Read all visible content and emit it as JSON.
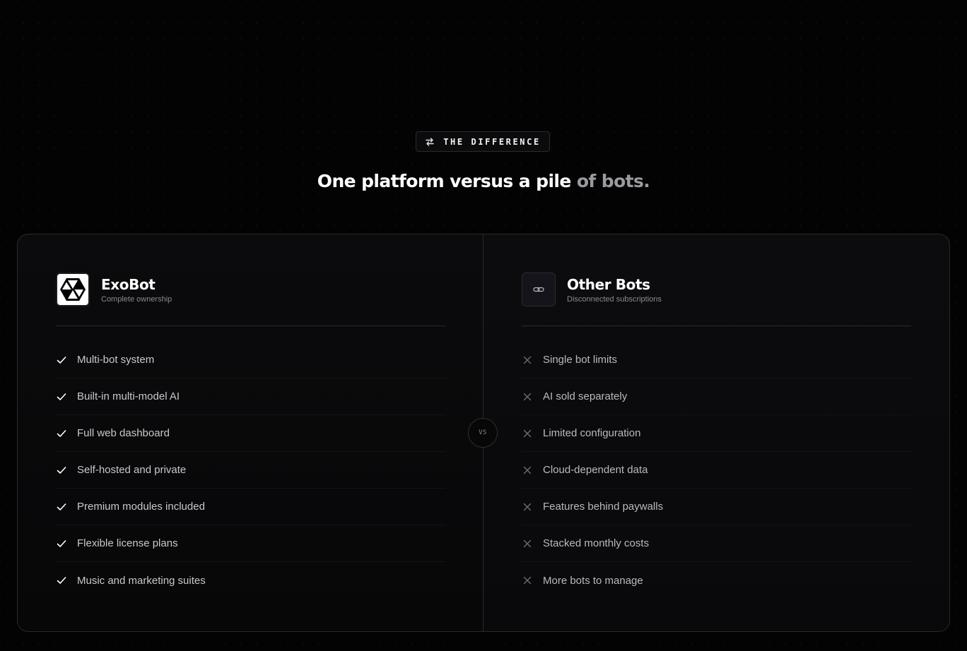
{
  "eyebrow": {
    "icon": "swap-arrows-icon",
    "label": "THE DIFFERENCE"
  },
  "headline": {
    "strong": "One platform versus a pile",
    "muted": " of bots."
  },
  "exobot": {
    "logo_icon": "exobot-hexagon-logo-icon",
    "title": "ExoBot",
    "subtitle": "Complete ownership",
    "mark_icon": "check-icon",
    "items": [
      {
        "label": "Multi-bot system"
      },
      {
        "label": "Built-in multi-model AI"
      },
      {
        "label": "Full web dashboard"
      },
      {
        "label": "Self-hosted and private"
      },
      {
        "label": "Premium modules included"
      },
      {
        "label": "Flexible license plans"
      },
      {
        "label": "Music and marketing suites"
      }
    ]
  },
  "vs_label": "VS",
  "others": {
    "logo_icon": "chain-link-icon",
    "title": "Other Bots",
    "subtitle": "Disconnected subscriptions",
    "mark_icon": "x-icon",
    "items": [
      {
        "label": "Single bot limits"
      },
      {
        "label": "AI sold separately"
      },
      {
        "label": "Limited configuration"
      },
      {
        "label": "Cloud-dependent data"
      },
      {
        "label": "Features behind paywalls"
      },
      {
        "label": "Stacked monthly costs"
      },
      {
        "label": "More bots to manage"
      }
    ]
  },
  "colors": {
    "background": "#030304",
    "card_border": "#2a2a2e",
    "text_primary": "#ffffff",
    "text_muted": "#9a9aa0",
    "check": "#ffffff",
    "cross": "#6f6f75"
  }
}
